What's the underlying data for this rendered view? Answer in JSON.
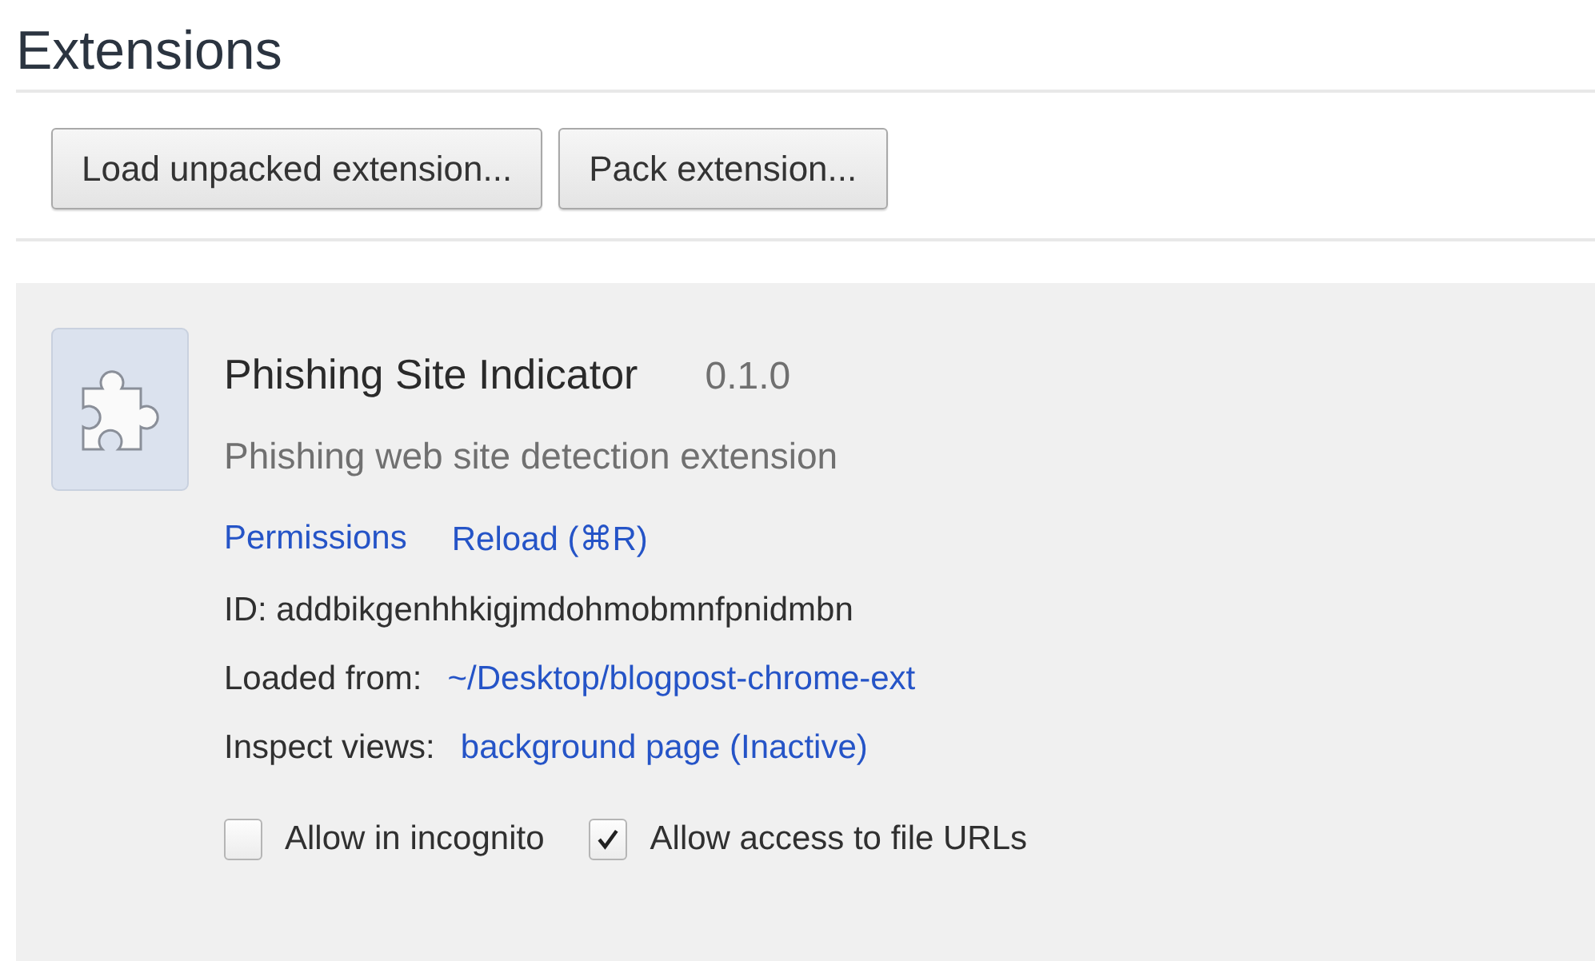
{
  "page": {
    "title": "Extensions"
  },
  "buttons": [
    "Load unpacked extension...",
    "Pack extension..."
  ],
  "extension": {
    "name": "Phishing Site Indicator",
    "version": "0.1.0",
    "description": "Phishing web site detection extension",
    "links": [
      "Permissions",
      "Reload (⌘R)"
    ],
    "id_line": "ID: addbikgenhhkigjmdohmobmnfpnidmbn",
    "details": [
      {
        "label": "Loaded from:",
        "link": "~/Desktop/blogpost-chrome-ext"
      },
      {
        "label": "Inspect views:",
        "link": "background page (Inactive)"
      }
    ],
    "options": [
      {
        "label": "Allow in incognito",
        "checked": false
      },
      {
        "label": "Allow access to file URLs",
        "checked": true
      }
    ]
  }
}
